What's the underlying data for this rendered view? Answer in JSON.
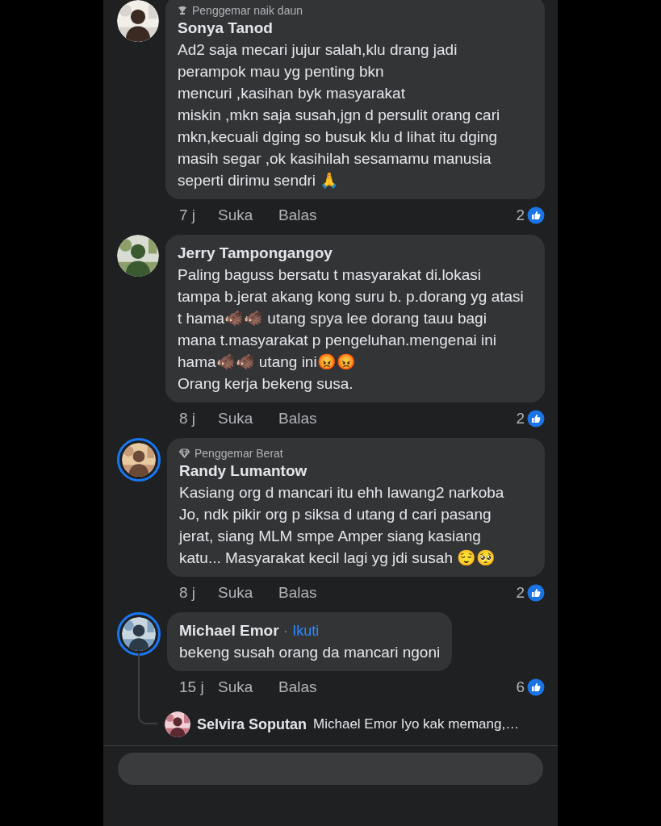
{
  "comments": [
    {
      "badge": {
        "kind": "trophy",
        "label": "Penggemar naik daun"
      },
      "author": "Sonya Tanod",
      "story_ring": false,
      "text": "Ad2 saja mecari jujur salah,klu drang jadi perampok mau yg penting bkn\nmencuri ,kasihan byk masyarakat\nmiskin ,mkn saja susah,jgn d persulit orang cari mkn,kecuali dging so busuk klu d lihat itu dging masih segar ,ok kasihilah sesamamu manusia seperti dirimu sendri 🙏",
      "time": "7 j",
      "like_label": "Suka",
      "reply_label": "Balas",
      "like_count": "2"
    },
    {
      "author": "Jerry Tampongangoy",
      "story_ring": false,
      "text": "Paling baguss bersatu t masyarakat di.lokasi tampa b.jerat akang kong suru b. p.dorang yg atasi t hama🐗🐗 utang spya lee dorang tauu bagi mana t.masyarakat p pengeluhan.mengenai ini hama🐗🐗 utang ini😡😡\nOrang kerja bekeng susa.",
      "time": "8 j",
      "like_label": "Suka",
      "reply_label": "Balas",
      "like_count": "2"
    },
    {
      "badge": {
        "kind": "diamond",
        "label": "Penggemar Berat"
      },
      "author": "Randy Lumantow",
      "story_ring": true,
      "text": "Kasiang org d mancari itu ehh lawang2 narkoba Jo, ndk pikir org p siksa d utang d cari pasang jerat, siang MLM smpe Amper siang kasiang katu... Masyarakat kecil lagi yg jdi susah 😌🥺",
      "time": "8 j",
      "like_label": "Suka",
      "reply_label": "Balas",
      "like_count": "2"
    },
    {
      "author": "Michael Emor",
      "separator": "·",
      "follow": "Ikuti",
      "story_ring": true,
      "text": "bekeng susah orang da mancari ngoni",
      "time": "15 j",
      "like_label": "Suka",
      "reply_label": "Balas",
      "like_count": "6",
      "reply_preview": {
        "author": "Selvira Soputan",
        "text": "Michael Emor Iyo kak memang,…"
      }
    }
  ],
  "composer": {
    "kind": "field"
  }
}
